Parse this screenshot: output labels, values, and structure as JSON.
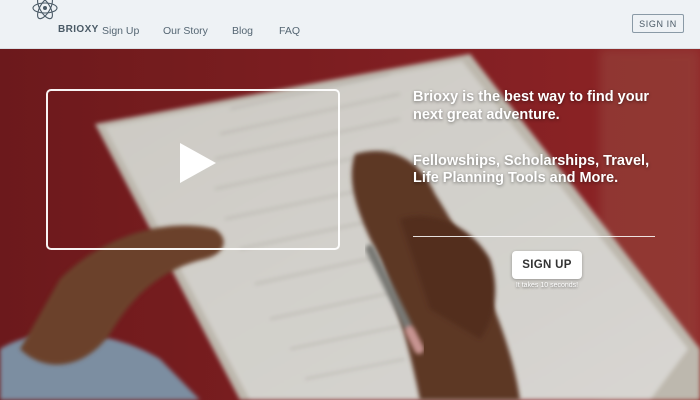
{
  "header": {
    "logo_text": "BRIOXY",
    "nav": [
      "Sign Up",
      "Our Story",
      "Blog",
      "FAQ"
    ],
    "signin_label": "SIGN IN"
  },
  "hero": {
    "headline": "Brioxy is the best way to find your next great adventure.",
    "subline": "Fellowships, Scholarships, Travel, Life Planning Tools and More.",
    "cta_label": "SIGN UP",
    "cta_note": "It takes 10 seconds!"
  },
  "icons": {
    "logo": "atom-logo-icon",
    "video": "play-icon"
  },
  "colors": {
    "header_bg": "#eef2f5",
    "hero_red": "#8e2326",
    "text_muted": "#556673",
    "cta_bg": "#ffffff"
  }
}
